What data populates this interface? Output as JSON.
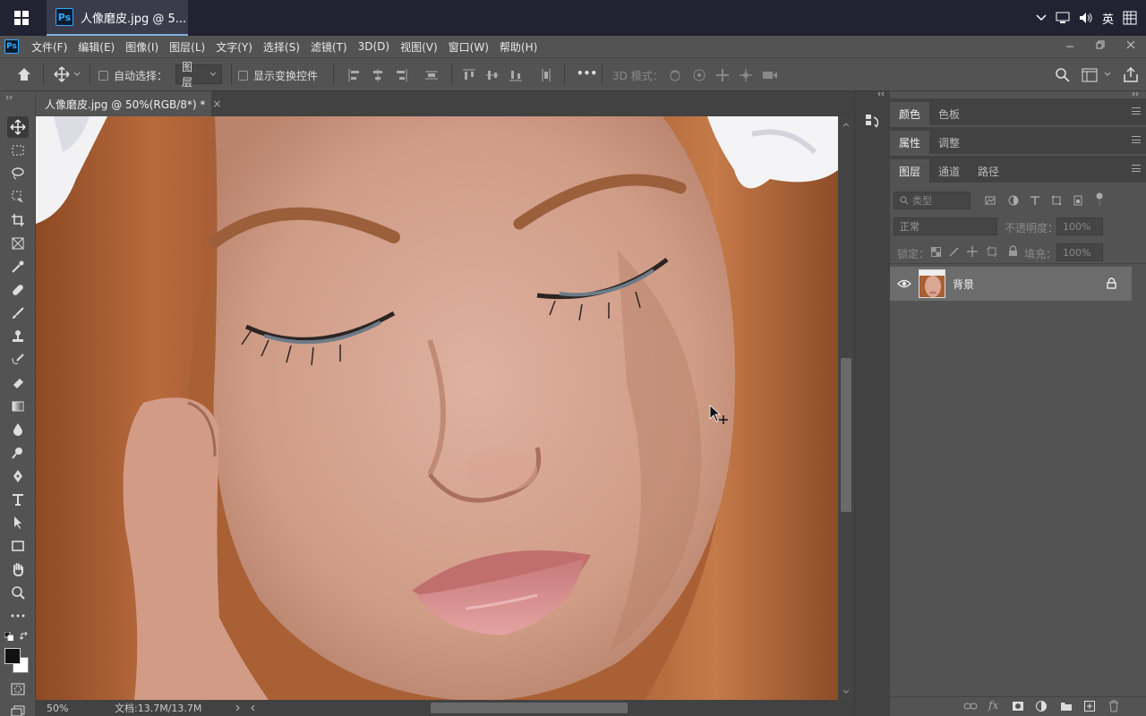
{
  "taskbar": {
    "app_title": "人像磨皮.jpg @ 5...",
    "ps_label": "Ps",
    "ime": "英"
  },
  "menu": {
    "ps_label": "Ps",
    "items": [
      "文件(F)",
      "编辑(E)",
      "图像(I)",
      "图层(L)",
      "文字(Y)",
      "选择(S)",
      "滤镜(T)",
      "3D(D)",
      "视图(V)",
      "窗口(W)",
      "帮助(H)"
    ]
  },
  "options": {
    "auto_select_label": "自动选择：",
    "auto_select_value": "图层",
    "show_transform_label": "显示变换控件",
    "more": "•••",
    "mode3d_label": "3D 模式："
  },
  "document": {
    "tab_title": "人像磨皮.jpg @ 50%(RGB/8*) *",
    "close": "×"
  },
  "status": {
    "zoom": "50%",
    "doc_size": "文档:13.7M/13.7M"
  },
  "panels": {
    "group1": {
      "tabs": [
        "颜色",
        "色板"
      ]
    },
    "group2": {
      "tabs": [
        "属性",
        "调整"
      ]
    },
    "layers": {
      "tabs": [
        "图层",
        "通道",
        "路径"
      ],
      "filter_placeholder": "类型",
      "blend_mode": "正常",
      "opacity_label": "不透明度：",
      "opacity_value": "100%",
      "lock_label": "锁定：",
      "fill_label": "填充：",
      "fill_value": "100%",
      "items": [
        {
          "name": "背景",
          "visible": true,
          "locked": true
        }
      ]
    }
  },
  "colors": {
    "accent": "#31a8ff",
    "panel_bg": "#535353",
    "dark_bg": "#424242"
  }
}
